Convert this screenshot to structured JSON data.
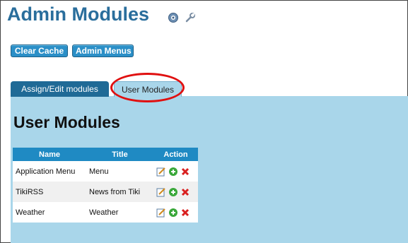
{
  "header": {
    "title": "Admin Modules",
    "icons": [
      "help-icon",
      "wrench-icon"
    ]
  },
  "toolbar": {
    "clear_cache_label": "Clear Cache",
    "admin_menus_label": "Admin Menus"
  },
  "tabs": [
    {
      "label": "Assign/Edit modules",
      "active": false
    },
    {
      "label": "User Modules",
      "active": true
    }
  ],
  "section": {
    "heading": "User Modules"
  },
  "table": {
    "columns": [
      "Name",
      "Title",
      "Action"
    ],
    "rows": [
      {
        "name": "Application Menu",
        "title": "Menu",
        "actions": [
          "edit-icon",
          "add-icon",
          "delete-icon"
        ]
      },
      {
        "name": "TikiRSS",
        "title": "News from Tiki",
        "actions": [
          "edit-icon",
          "add-icon",
          "delete-icon"
        ]
      },
      {
        "name": "Weather",
        "title": "Weather",
        "actions": [
          "edit-icon",
          "add-icon",
          "delete-icon"
        ]
      }
    ]
  },
  "colors": {
    "title": "#2a6e9c",
    "button": "#2b8fc7",
    "panel": "#a9d6ea",
    "table_header": "#1f8ac3",
    "highlight": "#e01010"
  }
}
